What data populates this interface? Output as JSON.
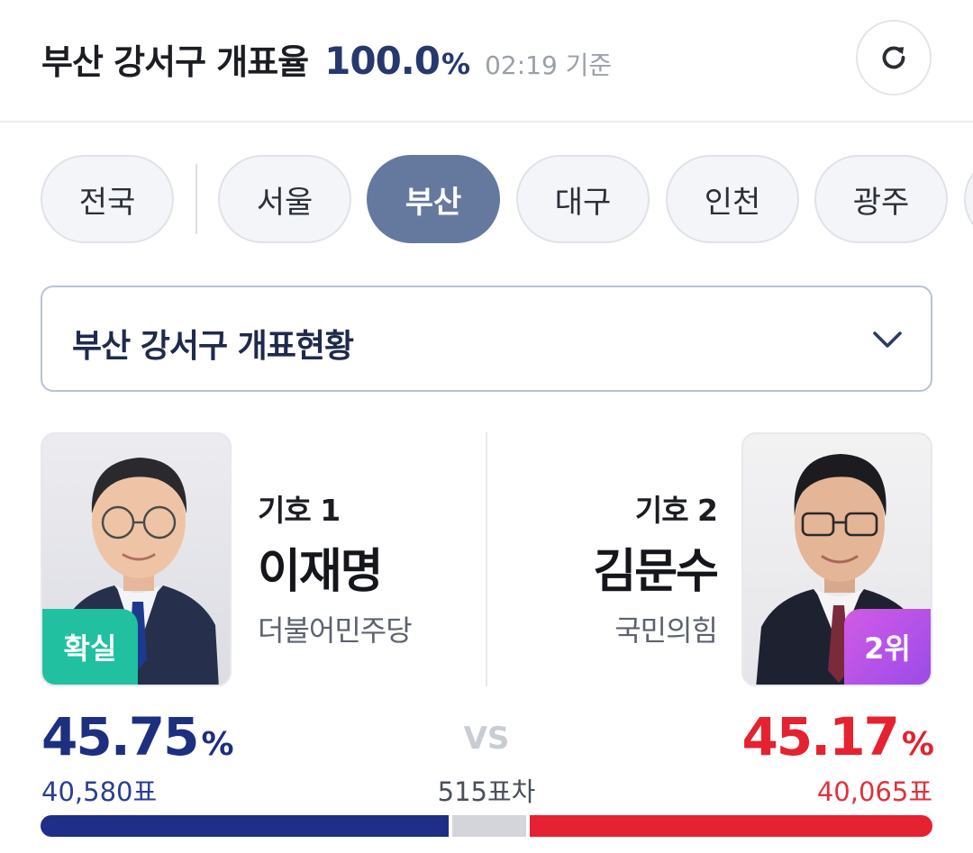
{
  "header": {
    "title": "부산 강서구 개표율",
    "rate": "100.0",
    "rate_unit": "%",
    "time": "02:19 기준",
    "refresh_icon": "refresh-icon"
  },
  "tabs": [
    {
      "label": "전국",
      "active": false
    },
    {
      "label": "서울",
      "active": false
    },
    {
      "label": "부산",
      "active": true
    },
    {
      "label": "대구",
      "active": false
    },
    {
      "label": "인천",
      "active": false
    },
    {
      "label": "광주",
      "active": false
    }
  ],
  "dropdown": {
    "label": "부산 강서구 개표현황",
    "icon": "chevron-down-icon"
  },
  "candidates": {
    "left": {
      "number": "기호 1",
      "name": "이재명",
      "party": "더불어민주당",
      "badge": "확실",
      "percent": "45.75",
      "percent_unit": "%",
      "votes": "40,580표",
      "share": 0.4575,
      "color": "#1f2e86"
    },
    "right": {
      "number": "기호 2",
      "name": "김문수",
      "party": "국민의힘",
      "badge": "2위",
      "percent": "45.17",
      "percent_unit": "%",
      "votes": "40,065표",
      "share": 0.4517,
      "color": "#e52231"
    }
  },
  "vs_label": "VS",
  "difference": "515표차",
  "colors": {
    "accent": "#27386d",
    "active_tab": "#65799f",
    "win_badge": "#20c0a0",
    "rank_badge": "#b654e8"
  }
}
